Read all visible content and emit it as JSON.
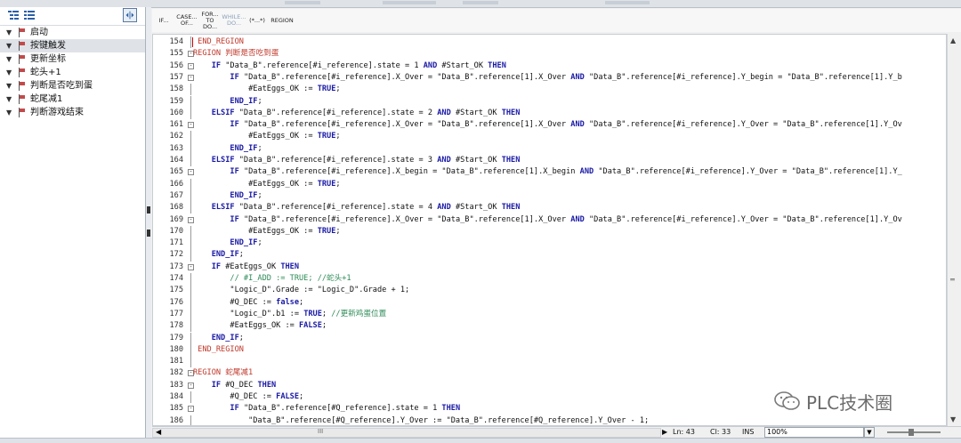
{
  "left_panel": {
    "items": [
      {
        "label": "启动",
        "selected": false
      },
      {
        "label": "按键触发",
        "selected": true
      },
      {
        "label": "更新坐标",
        "selected": false
      },
      {
        "label": "蛇头+1",
        "selected": false
      },
      {
        "label": "判断是否吃到蛋",
        "selected": false
      },
      {
        "label": "蛇尾减1",
        "selected": false
      },
      {
        "label": "判断游戏结束",
        "selected": false
      }
    ]
  },
  "instruction_toolbar": {
    "buttons": [
      {
        "label": "IF...",
        "dim": false
      },
      {
        "label": "CASE... OF...",
        "dim": false
      },
      {
        "label": "FOR... TO DO...",
        "dim": false
      },
      {
        "label": "WHILE... DO...",
        "dim": true
      },
      {
        "label": "(*...*)",
        "dim": false
      },
      {
        "label": "REGION",
        "dim": false
      }
    ]
  },
  "editor": {
    "lines": [
      {
        "n": "154",
        "fold": "",
        "code": " END_REGION",
        "type": "region"
      },
      {
        "n": "155",
        "fold": "minus",
        "code": "REGION 判断是否吃到蛋",
        "type": "region"
      },
      {
        "n": "156",
        "fold": "minus",
        "code": "    IF \"Data_B\".reference[#i_reference].state = 1 AND #Start_OK THEN",
        "type": "code"
      },
      {
        "n": "157",
        "fold": "minus",
        "code": "        IF \"Data_B\".reference[#i_reference].X_Over = \"Data_B\".reference[1].X_Over AND \"Data_B\".reference[#i_reference].Y_begin = \"Data_B\".reference[1].Y_b",
        "type": "code"
      },
      {
        "n": "158",
        "fold": "",
        "code": "            #EatEggs_OK := TRUE;",
        "type": "code"
      },
      {
        "n": "159",
        "fold": "",
        "code": "        END_IF;",
        "type": "code"
      },
      {
        "n": "160",
        "fold": "",
        "code": "    ELSIF \"Data_B\".reference[#i_reference].state = 2 AND #Start_OK THEN",
        "type": "code"
      },
      {
        "n": "161",
        "fold": "minus",
        "code": "        IF \"Data_B\".reference[#i_reference].X_Over = \"Data_B\".reference[1].X_Over AND \"Data_B\".reference[#i_reference].Y_Over = \"Data_B\".reference[1].Y_Ov",
        "type": "code"
      },
      {
        "n": "162",
        "fold": "",
        "code": "            #EatEggs_OK := TRUE;",
        "type": "code"
      },
      {
        "n": "163",
        "fold": "",
        "code": "        END_IF;",
        "type": "code"
      },
      {
        "n": "164",
        "fold": "",
        "code": "    ELSIF \"Data_B\".reference[#i_reference].state = 3 AND #Start_OK THEN",
        "type": "code"
      },
      {
        "n": "165",
        "fold": "minus",
        "code": "        IF \"Data_B\".reference[#i_reference].X_begin = \"Data_B\".reference[1].X_begin AND \"Data_B\".reference[#i_reference].Y_Over = \"Data_B\".reference[1].Y_",
        "type": "code"
      },
      {
        "n": "166",
        "fold": "",
        "code": "            #EatEggs_OK := TRUE;",
        "type": "code"
      },
      {
        "n": "167",
        "fold": "",
        "code": "        END_IF;",
        "type": "code"
      },
      {
        "n": "168",
        "fold": "",
        "code": "    ELSIF \"Data_B\".reference[#i_reference].state = 4 AND #Start_OK THEN",
        "type": "code"
      },
      {
        "n": "169",
        "fold": "minus",
        "code": "        IF \"Data_B\".reference[#i_reference].X_Over = \"Data_B\".reference[1].X_Over AND \"Data_B\".reference[#i_reference].Y_Over = \"Data_B\".reference[1].Y_Ov",
        "type": "code"
      },
      {
        "n": "170",
        "fold": "",
        "code": "            #EatEggs_OK := TRUE;",
        "type": "code"
      },
      {
        "n": "171",
        "fold": "",
        "code": "        END_IF;",
        "type": "code"
      },
      {
        "n": "172",
        "fold": "",
        "code": "    END_IF;",
        "type": "code"
      },
      {
        "n": "173",
        "fold": "minus",
        "code": "    IF #EatEggs_OK THEN",
        "type": "code"
      },
      {
        "n": "174",
        "fold": "",
        "code": "        // #I_ADD := TRUE; //蛇头+1",
        "type": "comment"
      },
      {
        "n": "175",
        "fold": "",
        "code": "        \"Logic_D\".Grade := \"Logic_D\".Grade + 1;",
        "type": "code"
      },
      {
        "n": "176",
        "fold": "",
        "code": "        #Q_DEC := false;",
        "type": "code"
      },
      {
        "n": "177",
        "fold": "",
        "code": "        \"Logic_D\".b1 := TRUE; //更新鸡蛋位置",
        "type": "code"
      },
      {
        "n": "178",
        "fold": "",
        "code": "        #EatEggs_OK := FALSE;",
        "type": "code"
      },
      {
        "n": "179",
        "fold": "",
        "code": "    END_IF;",
        "type": "code"
      },
      {
        "n": "180",
        "fold": "",
        "code": " END_REGION",
        "type": "region"
      },
      {
        "n": "181",
        "fold": "",
        "code": "",
        "type": "code"
      },
      {
        "n": "182",
        "fold": "minus",
        "code": "REGION 蛇尾减1",
        "type": "region"
      },
      {
        "n": "183",
        "fold": "minus",
        "code": "    IF #Q_DEC THEN",
        "type": "code"
      },
      {
        "n": "184",
        "fold": "",
        "code": "        #Q_DEC := FALSE;",
        "type": "code"
      },
      {
        "n": "185",
        "fold": "minus",
        "code": "        IF \"Data_B\".reference[#Q_reference].state = 1 THEN",
        "type": "code"
      },
      {
        "n": "186",
        "fold": "",
        "code": "            \"Data_B\".reference[#Q_reference].Y_Over := \"Data_B\".reference[#Q_reference].Y_Over - 1;",
        "type": "code"
      }
    ]
  },
  "status_bar": {
    "hscroll_grip": "III",
    "ln": "Ln: 43",
    "cl": "Cl: 33",
    "mode": "INS",
    "zoom": "100%"
  },
  "watermark": {
    "text": "PLC技术圈"
  },
  "colors": {
    "keyword": "#1a1aa6",
    "region": "#c0392b",
    "comment": "#2e8b57",
    "selection": "#dfe3e8"
  }
}
